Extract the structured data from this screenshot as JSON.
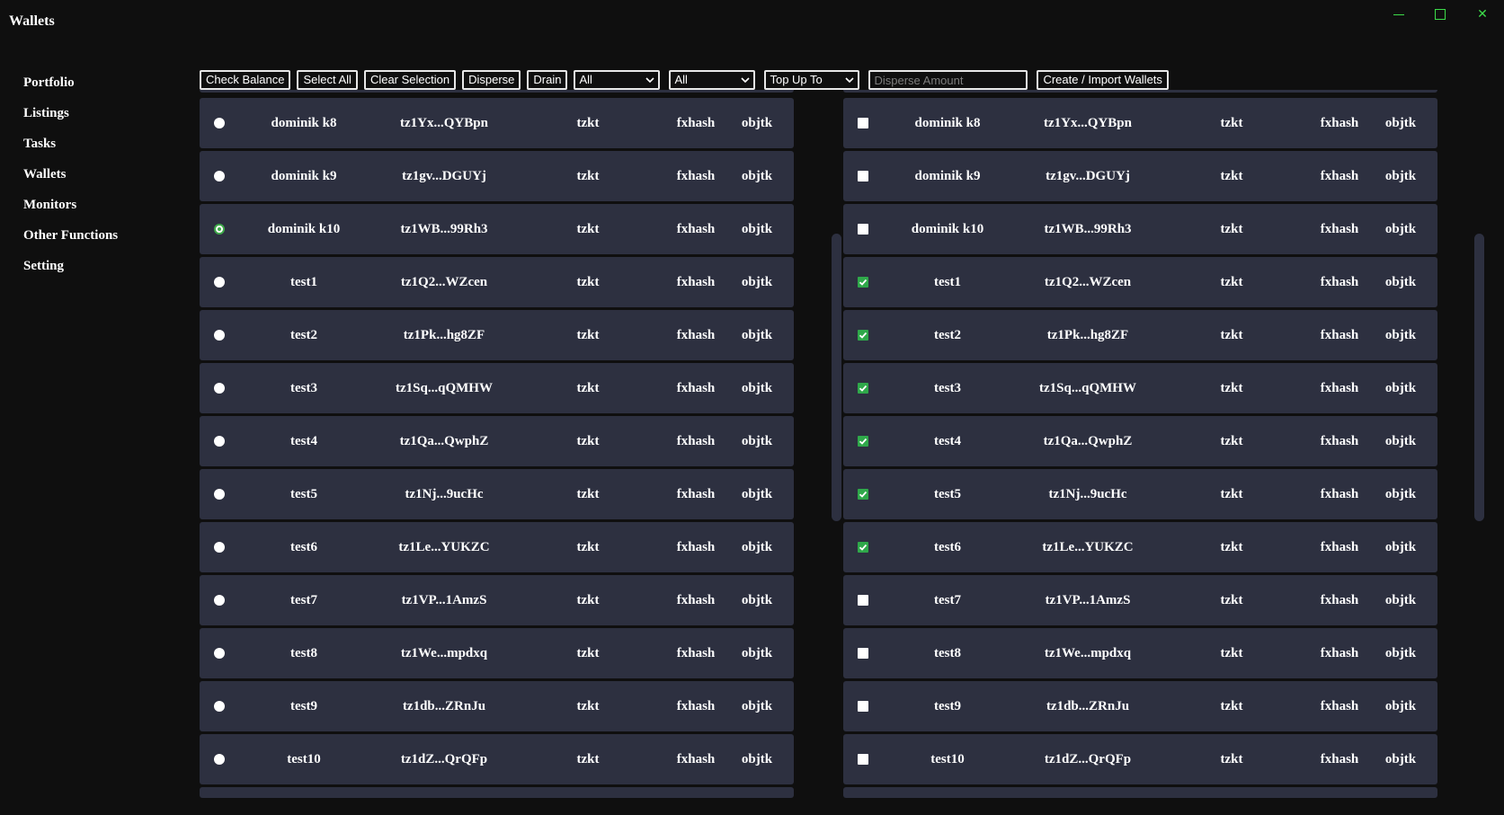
{
  "app": {
    "title": "Wallets"
  },
  "sidebar": {
    "items": [
      "Portfolio",
      "Listings",
      "Tasks",
      "Wallets",
      "Monitors",
      "Other Functions",
      "Setting"
    ]
  },
  "toolbar": {
    "buttons": [
      "Check Balance",
      "Select All",
      "Clear Selection",
      "Disperse",
      "Drain"
    ],
    "selects": [
      "All",
      "All",
      "Top Up To"
    ],
    "disperse_placeholder": "Disperse Amount",
    "create_label": "Create / Import Wallets"
  },
  "left_wallets": [
    {
      "name": "dominik k8",
      "address": "tz1Yx...QYBpn",
      "tzkt": "tzkt",
      "fxhash": "fxhash",
      "objkt": "objtk",
      "selected": false
    },
    {
      "name": "dominik k9",
      "address": "tz1gv...DGUYj",
      "tzkt": "tzkt",
      "fxhash": "fxhash",
      "objkt": "objtk",
      "selected": false
    },
    {
      "name": "dominik k10",
      "address": "tz1WB...99Rh3",
      "tzkt": "tzkt",
      "fxhash": "fxhash",
      "objkt": "objtk",
      "selected": true
    },
    {
      "name": "test1",
      "address": "tz1Q2...WZcen",
      "tzkt": "tzkt",
      "fxhash": "fxhash",
      "objkt": "objtk",
      "selected": false
    },
    {
      "name": "test2",
      "address": "tz1Pk...hg8ZF",
      "tzkt": "tzkt",
      "fxhash": "fxhash",
      "objkt": "objtk",
      "selected": false
    },
    {
      "name": "test3",
      "address": "tz1Sq...qQMHW",
      "tzkt": "tzkt",
      "fxhash": "fxhash",
      "objkt": "objtk",
      "selected": false
    },
    {
      "name": "test4",
      "address": "tz1Qa...QwphZ",
      "tzkt": "tzkt",
      "fxhash": "fxhash",
      "objkt": "objtk",
      "selected": false
    },
    {
      "name": "test5",
      "address": "tz1Nj...9ucHc",
      "tzkt": "tzkt",
      "fxhash": "fxhash",
      "objkt": "objtk",
      "selected": false
    },
    {
      "name": "test6",
      "address": "tz1Le...YUKZC",
      "tzkt": "tzkt",
      "fxhash": "fxhash",
      "objkt": "objtk",
      "selected": false
    },
    {
      "name": "test7",
      "address": "tz1VP...1AmzS",
      "tzkt": "tzkt",
      "fxhash": "fxhash",
      "objkt": "objtk",
      "selected": false
    },
    {
      "name": "test8",
      "address": "tz1We...mpdxq",
      "tzkt": "tzkt",
      "fxhash": "fxhash",
      "objkt": "objtk",
      "selected": false
    },
    {
      "name": "test9",
      "address": "tz1db...ZRnJu",
      "tzkt": "tzkt",
      "fxhash": "fxhash",
      "objkt": "objtk",
      "selected": false
    },
    {
      "name": "test10",
      "address": "tz1dZ...QrQFp",
      "tzkt": "tzkt",
      "fxhash": "fxhash",
      "objkt": "objtk",
      "selected": false
    }
  ],
  "right_wallets": [
    {
      "name": "dominik k8",
      "address": "tz1Yx...QYBpn",
      "tzkt": "tzkt",
      "fxhash": "fxhash",
      "objkt": "objtk",
      "checked": false
    },
    {
      "name": "dominik k9",
      "address": "tz1gv...DGUYj",
      "tzkt": "tzkt",
      "fxhash": "fxhash",
      "objkt": "objtk",
      "checked": false
    },
    {
      "name": "dominik k10",
      "address": "tz1WB...99Rh3",
      "tzkt": "tzkt",
      "fxhash": "fxhash",
      "objkt": "objtk",
      "checked": false
    },
    {
      "name": "test1",
      "address": "tz1Q2...WZcen",
      "tzkt": "tzkt",
      "fxhash": "fxhash",
      "objkt": "objtk",
      "checked": true
    },
    {
      "name": "test2",
      "address": "tz1Pk...hg8ZF",
      "tzkt": "tzkt",
      "fxhash": "fxhash",
      "objkt": "objtk",
      "checked": true
    },
    {
      "name": "test3",
      "address": "tz1Sq...qQMHW",
      "tzkt": "tzkt",
      "fxhash": "fxhash",
      "objkt": "objtk",
      "checked": true
    },
    {
      "name": "test4",
      "address": "tz1Qa...QwphZ",
      "tzkt": "tzkt",
      "fxhash": "fxhash",
      "objkt": "objtk",
      "checked": true
    },
    {
      "name": "test5",
      "address": "tz1Nj...9ucHc",
      "tzkt": "tzkt",
      "fxhash": "fxhash",
      "objkt": "objtk",
      "checked": true
    },
    {
      "name": "test6",
      "address": "tz1Le...YUKZC",
      "tzkt": "tzkt",
      "fxhash": "fxhash",
      "objkt": "objtk",
      "checked": true
    },
    {
      "name": "test7",
      "address": "tz1VP...1AmzS",
      "tzkt": "tzkt",
      "fxhash": "fxhash",
      "objkt": "objtk",
      "checked": false
    },
    {
      "name": "test8",
      "address": "tz1We...mpdxq",
      "tzkt": "tzkt",
      "fxhash": "fxhash",
      "objkt": "objtk",
      "checked": false
    },
    {
      "name": "test9",
      "address": "tz1db...ZRnJu",
      "tzkt": "tzkt",
      "fxhash": "fxhash",
      "objkt": "objtk",
      "checked": false
    },
    {
      "name": "test10",
      "address": "tz1dZ...QrQFp",
      "tzkt": "tzkt",
      "fxhash": "fxhash",
      "objkt": "objtk",
      "checked": false
    }
  ],
  "colors": {
    "background": "#0f0f0f",
    "row": "#2d3040",
    "accent_green": "#3ddc4a",
    "check_green": "#2fa84a"
  }
}
